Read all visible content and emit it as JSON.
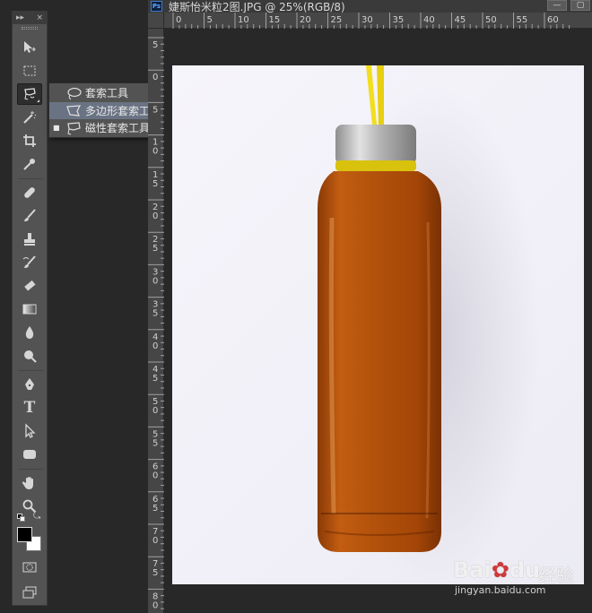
{
  "tool_panel": {
    "collapse_label": "▸▸",
    "close_label": "×",
    "tools": [
      {
        "name": "move-tool",
        "icon": "move-icon"
      },
      {
        "name": "marquee-tool",
        "icon": "rect-marquee-icon"
      },
      {
        "name": "lasso-tool",
        "icon": "magnetic-lasso-icon"
      },
      {
        "name": "quick-select-tool",
        "icon": "magic-wand-icon"
      },
      {
        "name": "crop-tool",
        "icon": "crop-icon"
      },
      {
        "name": "eyedropper-tool",
        "icon": "eyedropper-icon"
      },
      {
        "name": "healing-tool",
        "icon": "bandage-icon"
      },
      {
        "name": "brush-tool",
        "icon": "brush-icon"
      },
      {
        "name": "stamp-tool",
        "icon": "stamp-icon"
      },
      {
        "name": "history-brush-tool",
        "icon": "history-brush-icon"
      },
      {
        "name": "eraser-tool",
        "icon": "eraser-icon"
      },
      {
        "name": "gradient-tool",
        "icon": "gradient-icon"
      },
      {
        "name": "blur-tool",
        "icon": "drop-icon"
      },
      {
        "name": "dodge-tool",
        "icon": "dodge-icon"
      },
      {
        "name": "pen-tool",
        "icon": "pen-icon"
      },
      {
        "name": "type-tool",
        "icon": "type-icon"
      },
      {
        "name": "path-select-tool",
        "icon": "arrow-icon"
      },
      {
        "name": "shape-tool",
        "icon": "rounded-rect-icon"
      },
      {
        "name": "hand-tool",
        "icon": "hand-icon"
      },
      {
        "name": "zoom-tool",
        "icon": "zoom-icon"
      }
    ],
    "type_glyph": "T"
  },
  "flyout": {
    "items": [
      {
        "label": "套索工具",
        "key": "L",
        "icon": "lasso-icon",
        "selected": false
      },
      {
        "label": "多边形套索工具",
        "key": "L",
        "icon": "polygonal-lasso-icon",
        "selected": false
      },
      {
        "label": "磁性套索工具",
        "key": "L",
        "icon": "magnetic-lasso-icon",
        "selected": true
      }
    ],
    "bullet": "■"
  },
  "document": {
    "badge": "Ps",
    "title": "婕斯怡米粒2图.JPG @ 25%(RGB/8)",
    "win_min": "—",
    "win_max": "▢",
    "ruler_h_labels": [
      "0",
      "5",
      "10",
      "15",
      "20",
      "25",
      "30",
      "35",
      "40",
      "45",
      "50",
      "55",
      "60"
    ],
    "ruler_v_labels": [
      "5",
      "0",
      "5",
      "1\n0",
      "1\n5",
      "2\n0",
      "2\n5",
      "3\n0",
      "3\n5",
      "4\n0",
      "4\n5",
      "5\n0",
      "5\n5",
      "6\n0",
      "6\n5",
      "7\n0",
      "7\n5",
      "8\n0"
    ]
  },
  "watermark": {
    "logo_left": "Bai",
    "logo_right": "du",
    "chinese": "经验",
    "url": "jingyan.baidu.com"
  },
  "colors": {
    "panel": "#535353",
    "workspace": "#282828",
    "flyout_hover": "#6a7384",
    "bottle_liquid": "#b04f0a",
    "cap": "#c9c9c9",
    "strap": "#f2de1e"
  }
}
